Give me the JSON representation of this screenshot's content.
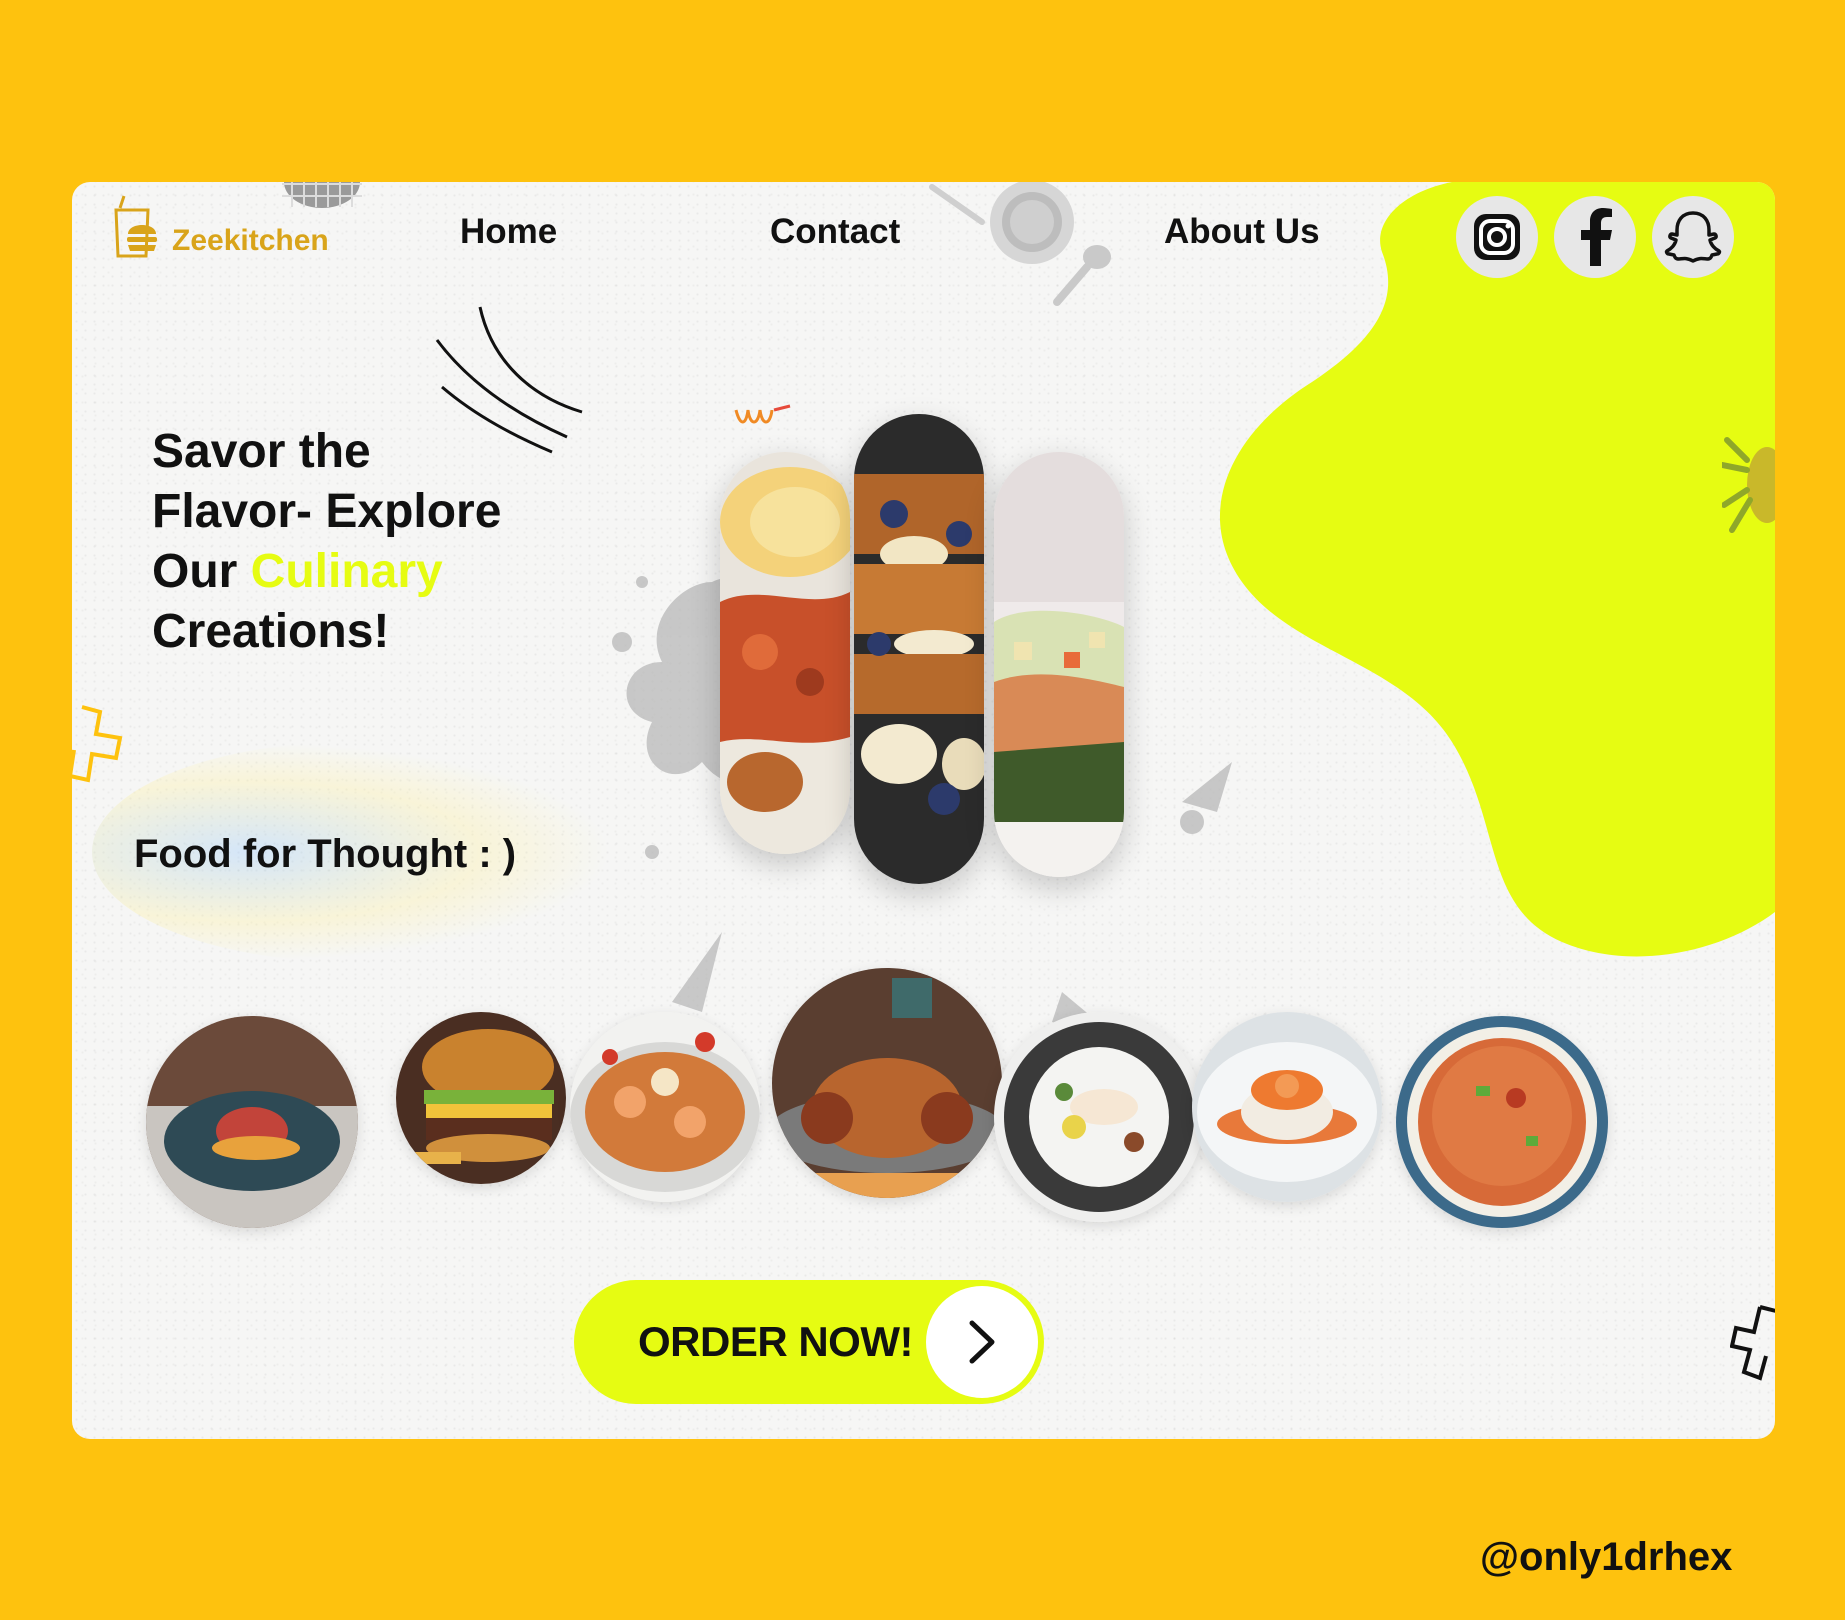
{
  "brand": {
    "name": "Zeekitchen",
    "logo_icon": "burger-drink-icon"
  },
  "nav": {
    "items": [
      "Home",
      "Contact",
      "About Us"
    ]
  },
  "social": [
    {
      "name": "instagram-icon"
    },
    {
      "name": "facebook-icon"
    },
    {
      "name": "snapchat-icon"
    }
  ],
  "hero": {
    "line1": "Savor the",
    "line2": "Flavor- Explore",
    "line3_prefix": "Our ",
    "line3_accent": "Culinary",
    "line4": "Creations!",
    "tagline": "Food for Thought  : )"
  },
  "cta": {
    "label": "ORDER NOW!",
    "icon": "chevron-right-icon"
  },
  "footer": {
    "handle": "@only1drhex"
  },
  "colors": {
    "frame": "#FEC20E",
    "accent": "#E6FC12",
    "card": "#F6F6F5",
    "logo": "#D9A41A"
  }
}
